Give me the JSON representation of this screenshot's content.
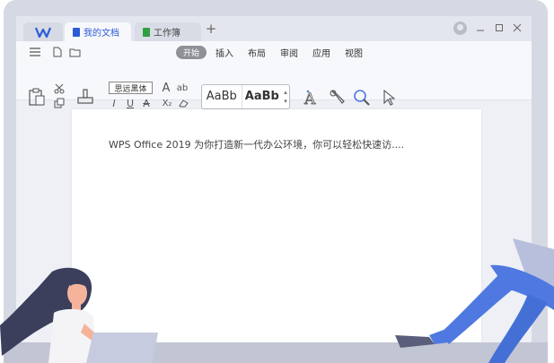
{
  "app": {
    "tabs": [
      {
        "label": "我的文档",
        "active": true,
        "icon": "doc-blue-icon",
        "color": "#2c5bd8"
      },
      {
        "label": "工作簿",
        "active": false,
        "icon": "sheet-green-icon",
        "color": "#2ea043"
      }
    ],
    "new_tab": "+"
  },
  "toolbar": {
    "menu": [
      "开始",
      "插入",
      "布局",
      "审阅",
      "应用",
      "视图"
    ],
    "font_name": "思远黑体",
    "style_presets": [
      "AaBb",
      "AaBb"
    ],
    "icons": [
      "menu-icon",
      "new-file-icon",
      "open-folder-icon",
      "paste-icon",
      "cut-icon",
      "copy-icon",
      "format-painter-icon",
      "font-size-icon",
      "change-case-icon",
      "italic-icon",
      "underline-icon",
      "strikethrough-icon",
      "subscript-icon",
      "clear-format-icon",
      "text-effect-icon",
      "tools-icon",
      "find-icon",
      "select-icon"
    ]
  },
  "document": {
    "text": "WPS Office 2019 为你打造新一代办公环境，你可以轻松快速访...."
  },
  "colors": {
    "accent": "#2c5bd8",
    "figure_blue": "#4f79e0",
    "figure_dark": "#3b3f5c"
  }
}
